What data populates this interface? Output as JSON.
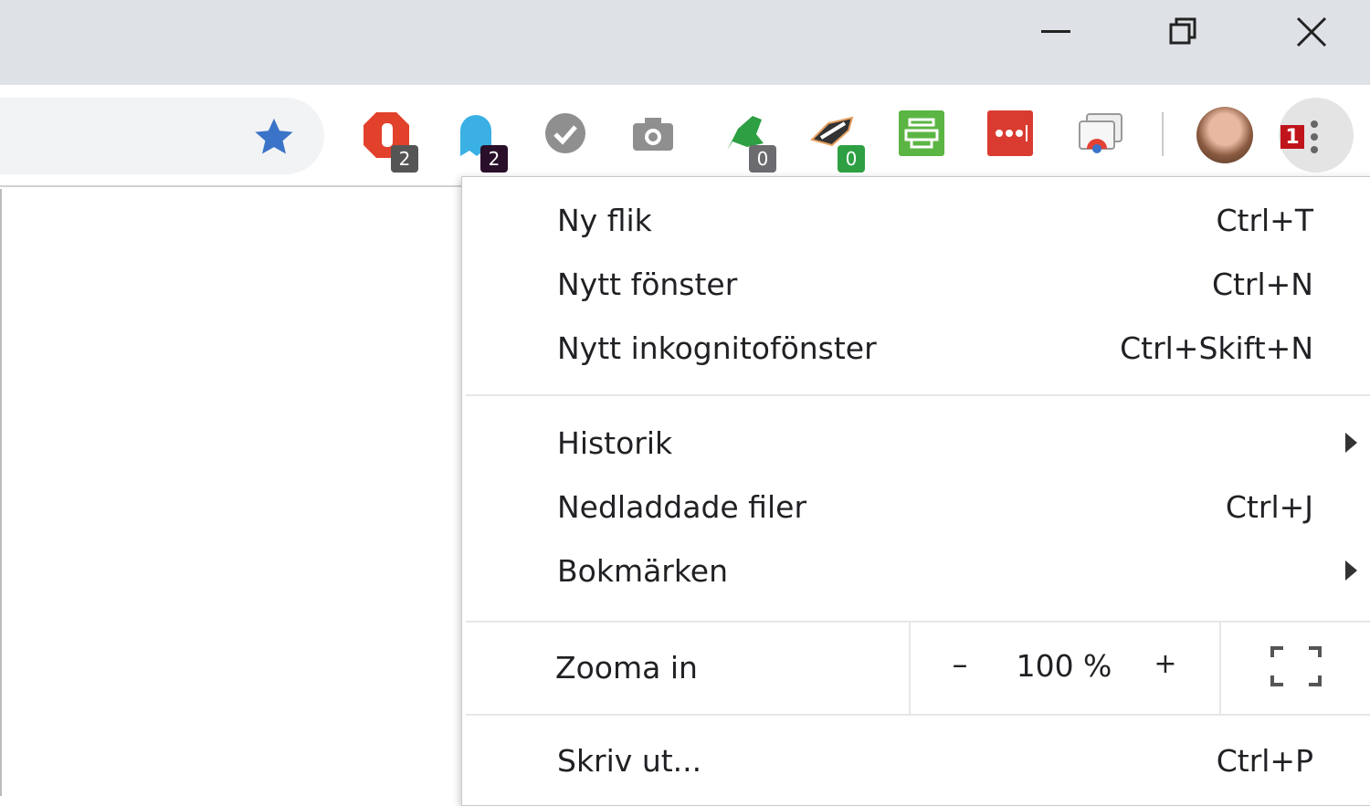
{
  "window": {
    "minimize": "minimize",
    "restore": "restore",
    "close": "close"
  },
  "toolbar": {
    "extensions": [
      {
        "name": "ublock",
        "badge": "2",
        "color": "#e2412b",
        "badge_color": "#555555"
      },
      {
        "name": "ghostery",
        "badge": "2",
        "color": "#3ab0e4",
        "badge_color": "#2a0f2a"
      },
      {
        "name": "checkmark",
        "color": "#8f8f8f"
      },
      {
        "name": "camera",
        "color": "#8f8f8f"
      },
      {
        "name": "avast",
        "badge": "0",
        "color": "#2ea043",
        "badge_color": "#6b6b70"
      },
      {
        "name": "privacy-badger",
        "badge": "0",
        "color": "#333333",
        "badge_color": "#2ea043"
      },
      {
        "name": "print-friendly",
        "color": "#5bb543"
      },
      {
        "name": "lastpass",
        "color": "#d93b30"
      },
      {
        "name": "cast",
        "color": "#999999"
      }
    ],
    "menu_badge": "1"
  },
  "menu": {
    "group1": [
      {
        "label": "Ny flik",
        "shortcut": "Ctrl+T"
      },
      {
        "label": "Nytt fönster",
        "shortcut": "Ctrl+N"
      },
      {
        "label": "Nytt inkognitofönster",
        "shortcut": "Ctrl+Skift+N"
      }
    ],
    "group2": [
      {
        "label": "Historik",
        "submenu": true
      },
      {
        "label": "Nedladdade filer",
        "shortcut": "Ctrl+J"
      },
      {
        "label": "Bokmärken",
        "submenu": true
      }
    ],
    "zoom": {
      "label": "Zooma in",
      "minus": "–",
      "value": "100 %",
      "plus": "+"
    },
    "print": {
      "label": "Skriv ut...",
      "shortcut": "Ctrl+P"
    }
  }
}
